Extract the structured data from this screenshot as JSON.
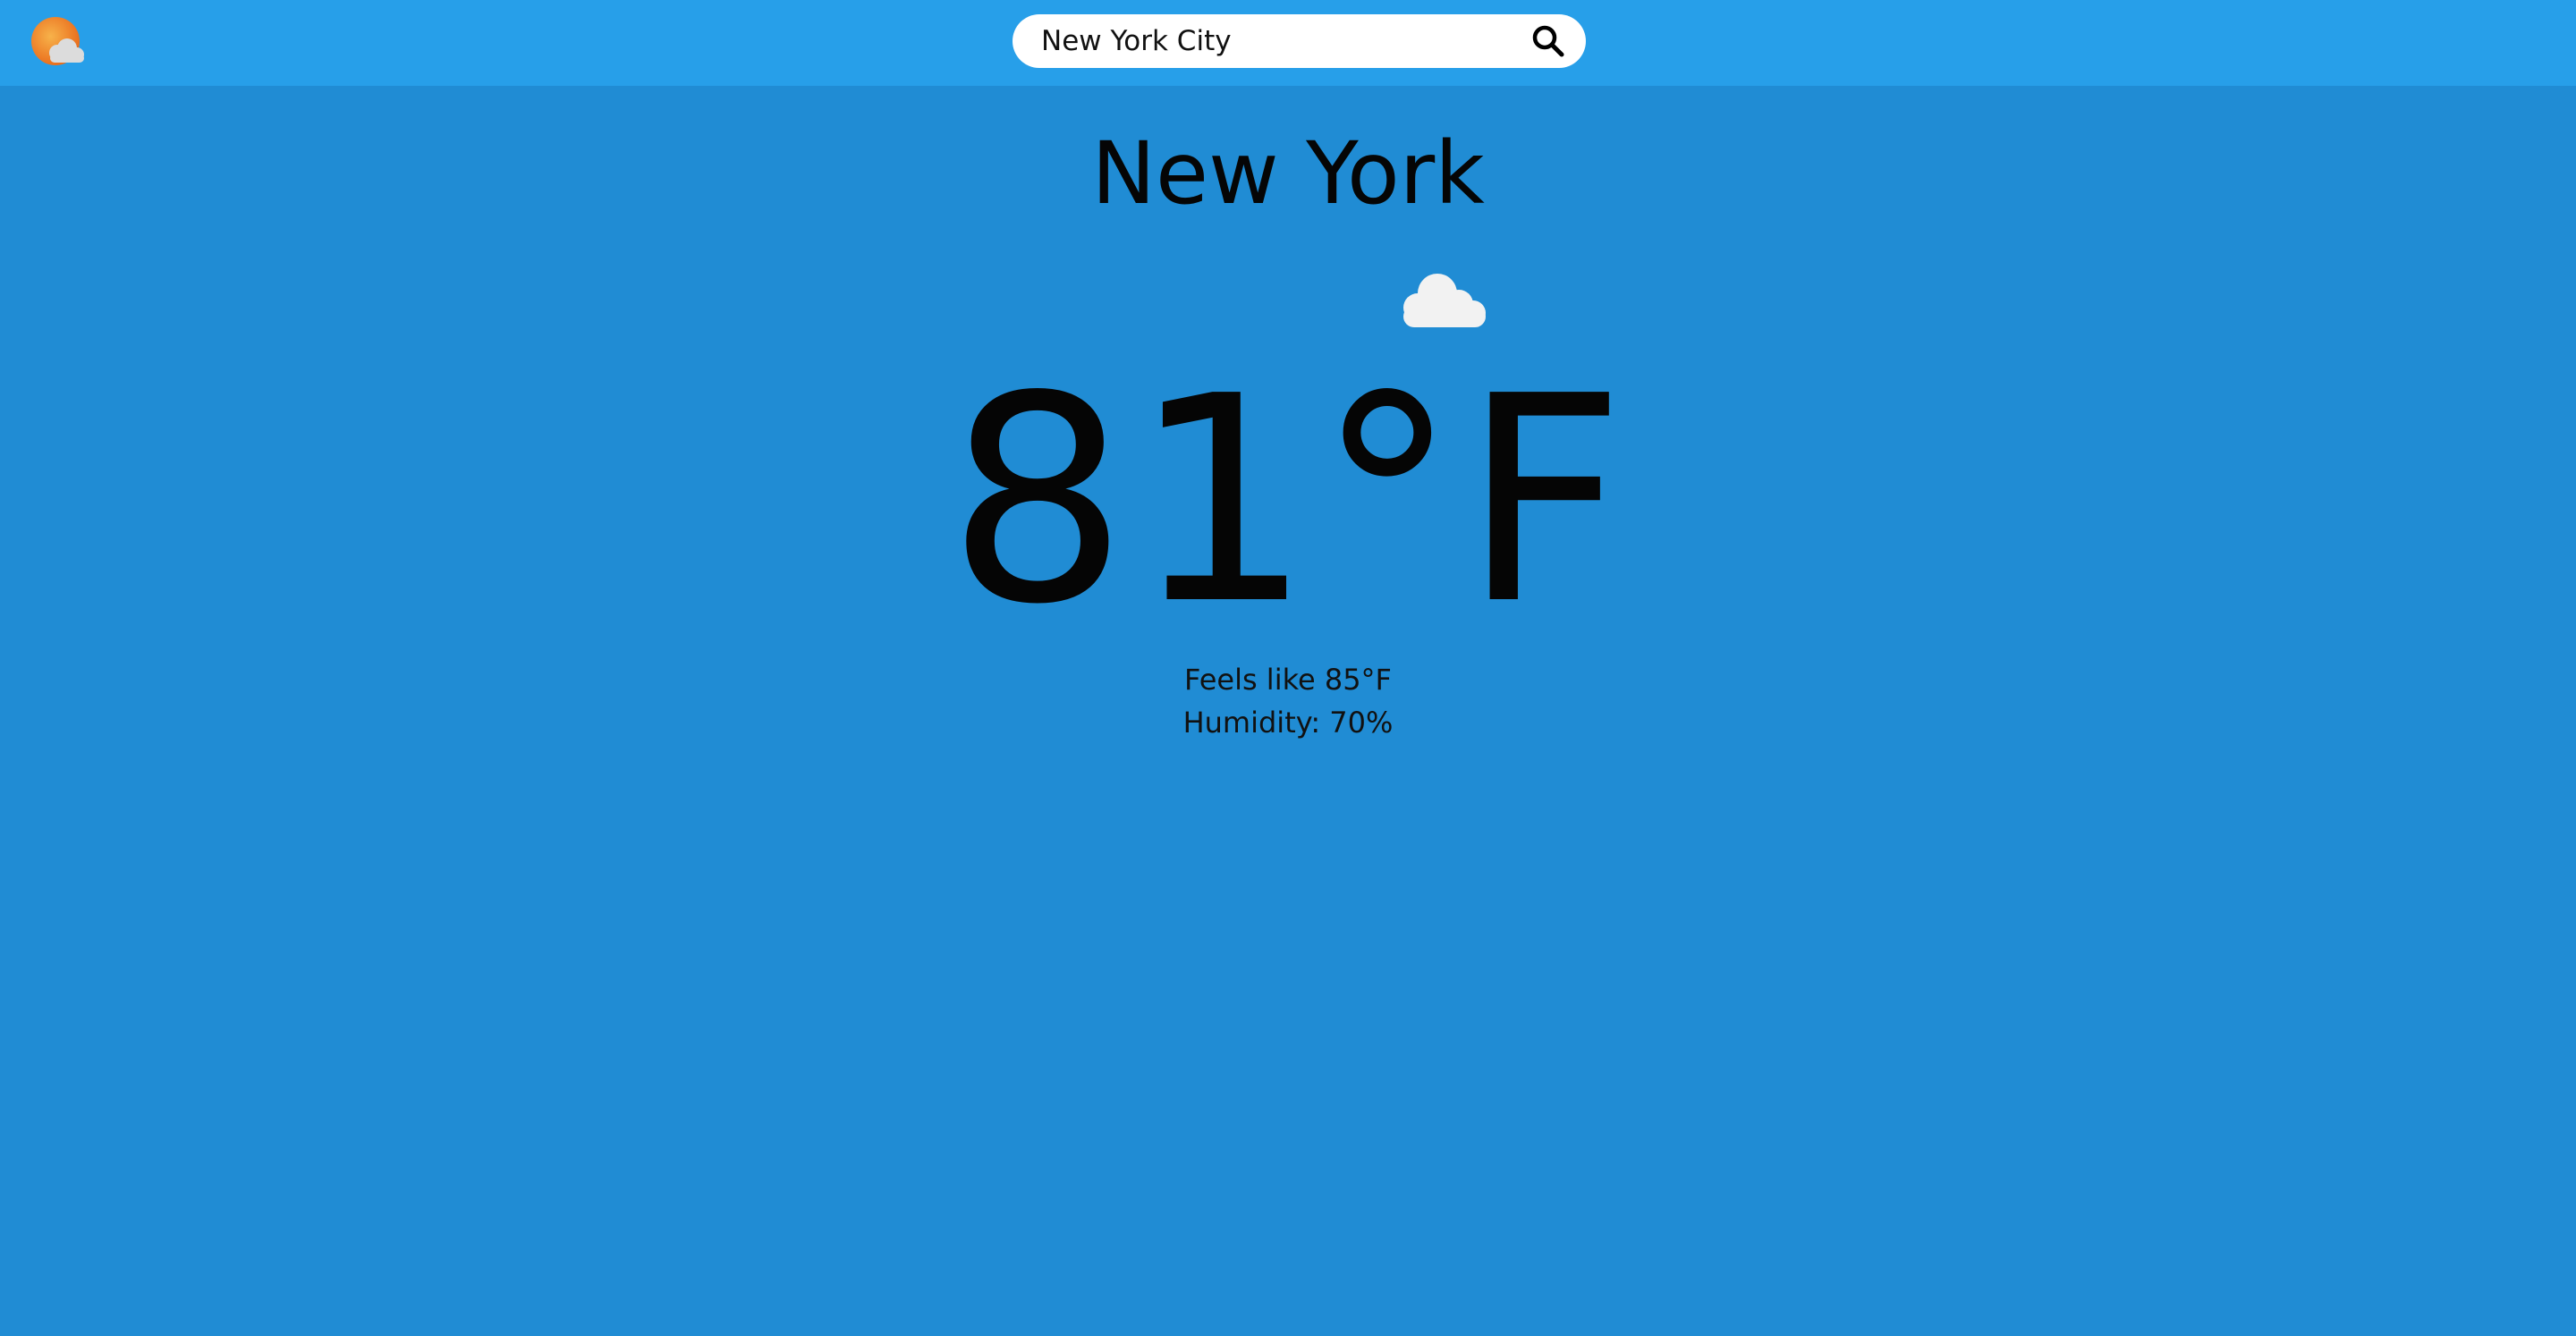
{
  "header": {
    "logo_icon": "sun-cloud-icon",
    "search": {
      "value": "New York City",
      "placeholder": "",
      "button_icon": "search-icon"
    }
  },
  "weather": {
    "city": "New York",
    "condition_icon": "cloud-icon",
    "temperature": "81°F",
    "feels_like": "Feels like 85°F",
    "humidity": "Humidity: 70%"
  },
  "colors": {
    "header_bg": "#279fe9",
    "page_bg": "#208cd4",
    "logo_sun": "#f08a2a",
    "cloud": "#f2f2f2"
  }
}
